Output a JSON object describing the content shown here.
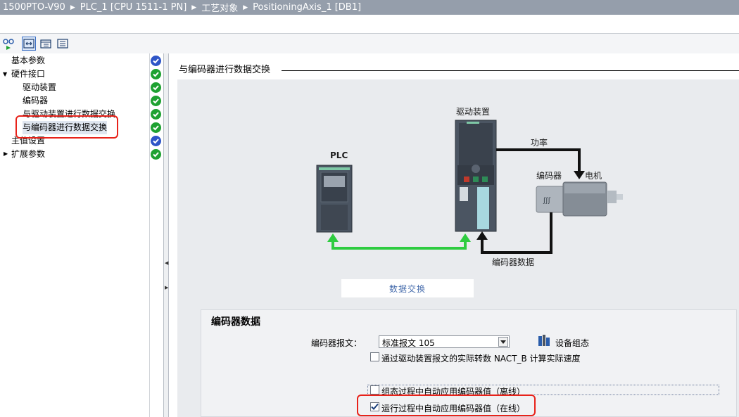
{
  "breadcrumb": [
    "1500PTO-V90",
    "PLC_1 [CPU 1511-1 PN]",
    "工艺对象",
    "PositioningAxis_1 [DB1]"
  ],
  "tree": {
    "items": [
      {
        "label": "基本参数",
        "status": "info"
      },
      {
        "label": "硬件接口",
        "status": "ok",
        "expander": "▼"
      },
      {
        "label": "驱动装置",
        "status": "ok"
      },
      {
        "label": "编码器",
        "status": "ok"
      },
      {
        "label": "与驱动装置进行数据交换",
        "status": "ok"
      },
      {
        "label": "与编码器进行数据交换",
        "status": "ok"
      },
      {
        "label": "主值设置",
        "status": "info"
      },
      {
        "label": "扩展参数",
        "status": "ok",
        "expander": "▶"
      }
    ]
  },
  "section": {
    "title": "与编码器进行数据交换"
  },
  "diagram": {
    "drive_label": "驱动装置",
    "plc_label": "PLC",
    "power_label": "功率",
    "encoder_label": "编码器",
    "motor_label": "电机",
    "data_exchange_label": "数据交换",
    "encoder_data_label": "编码器数据",
    "encoder_glyph": "ʃʃʃ"
  },
  "encoder_data": {
    "title": "编码器数据",
    "telegram_label": "编码器报文：",
    "telegram_value": "标准报文 105",
    "device_config_label": "设备组态",
    "cb_nact": {
      "label": "通过驱动装置报文的实际转数 NACT_B 计算实际速度",
      "checked": false
    },
    "cb_offline": {
      "label": "组态过程中自动应用编码器值（离线）",
      "checked": false
    },
    "cb_online": {
      "label": "运行过程中自动应用编码器值（在线）",
      "checked": true
    }
  },
  "colors": {
    "accent_green": "#2ecc40",
    "highlight_red": "#e8221a",
    "status_ok": "#1ea131",
    "status_info": "#2e55c7"
  }
}
